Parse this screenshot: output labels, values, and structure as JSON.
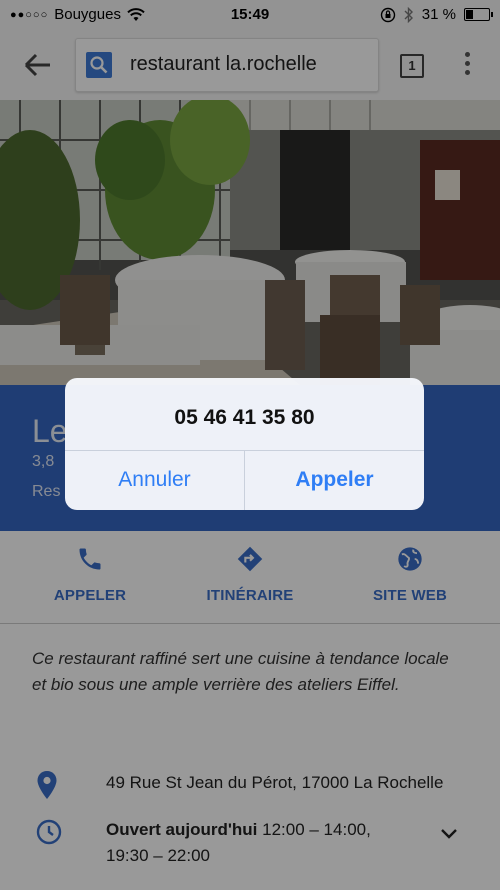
{
  "status_bar": {
    "signal_dots": "●●○○○",
    "carrier": "Bouygues",
    "time": "15:49",
    "battery_percent": "31 %",
    "battery_level": 0.31
  },
  "toolbar": {
    "search_query": "restaurant la.rochelle",
    "tab_count": "1"
  },
  "place": {
    "title_visible": "Le",
    "rating_visible": "3,8",
    "type_visible": "Res"
  },
  "actions": [
    {
      "label": "APPELER",
      "icon": "phone-icon"
    },
    {
      "label": "ITINÉRAIRE",
      "icon": "directions-icon"
    },
    {
      "label": "SITE WEB",
      "icon": "globe-icon"
    }
  ],
  "description": "Ce restaurant raffiné sert une cuisine à tendance locale et bio sous une ample verrière des ateliers Eiffel.",
  "address": "49 Rue St Jean du Pérot, 17000 La Rochelle",
  "hours": {
    "status": "Ouvert aujourd'hui",
    "slot1": " 12:00 – 14:00,",
    "slot2": "19:30 – 22:00"
  },
  "dialog": {
    "phone_number": "05 46 41 35 80",
    "cancel_label": "Annuler",
    "call_label": "Appeler"
  },
  "colors": {
    "accent_blue": "#3467c2",
    "ios_blue": "#2f7ef5"
  }
}
